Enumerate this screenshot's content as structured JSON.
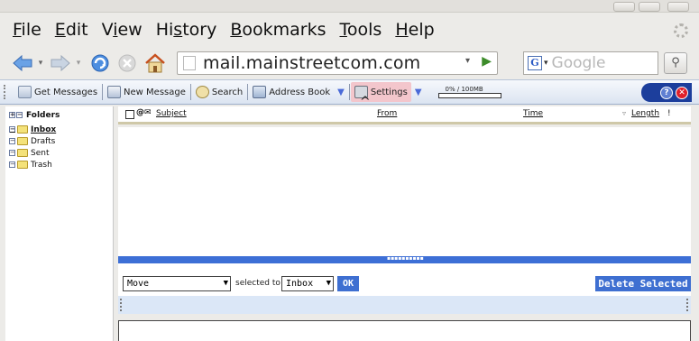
{
  "browser": {
    "menu": [
      "File",
      "Edit",
      "View",
      "History",
      "Bookmarks",
      "Tools",
      "Help"
    ],
    "menu_access": [
      "F",
      "E",
      "i",
      "s",
      "B",
      "T",
      "H"
    ],
    "url": "mail.mainstreetcom.com",
    "search_placeholder": "Google"
  },
  "toolbar": {
    "get_messages": "Get Messages",
    "new_message": "New Message",
    "search": "Search",
    "address_book": "Address Book",
    "settings": "Settings",
    "quota": "0% / 100MB"
  },
  "folders": {
    "header": "Folders",
    "items": [
      "Inbox",
      "Drafts",
      "Sent",
      "Trash"
    ]
  },
  "list": {
    "columns": [
      "Subject",
      "From",
      "Time",
      "Length",
      "!"
    ]
  },
  "actions": {
    "move_select": "Move",
    "selected_to": "selected to",
    "target_folder": "Inbox",
    "ok": "OK",
    "delete_selected": "Delete Selected"
  },
  "colors": {
    "accent": "#3e6fd1",
    "toolbar_pill": "#1c3e9c",
    "settings_highlight": "#f3c6cc"
  }
}
